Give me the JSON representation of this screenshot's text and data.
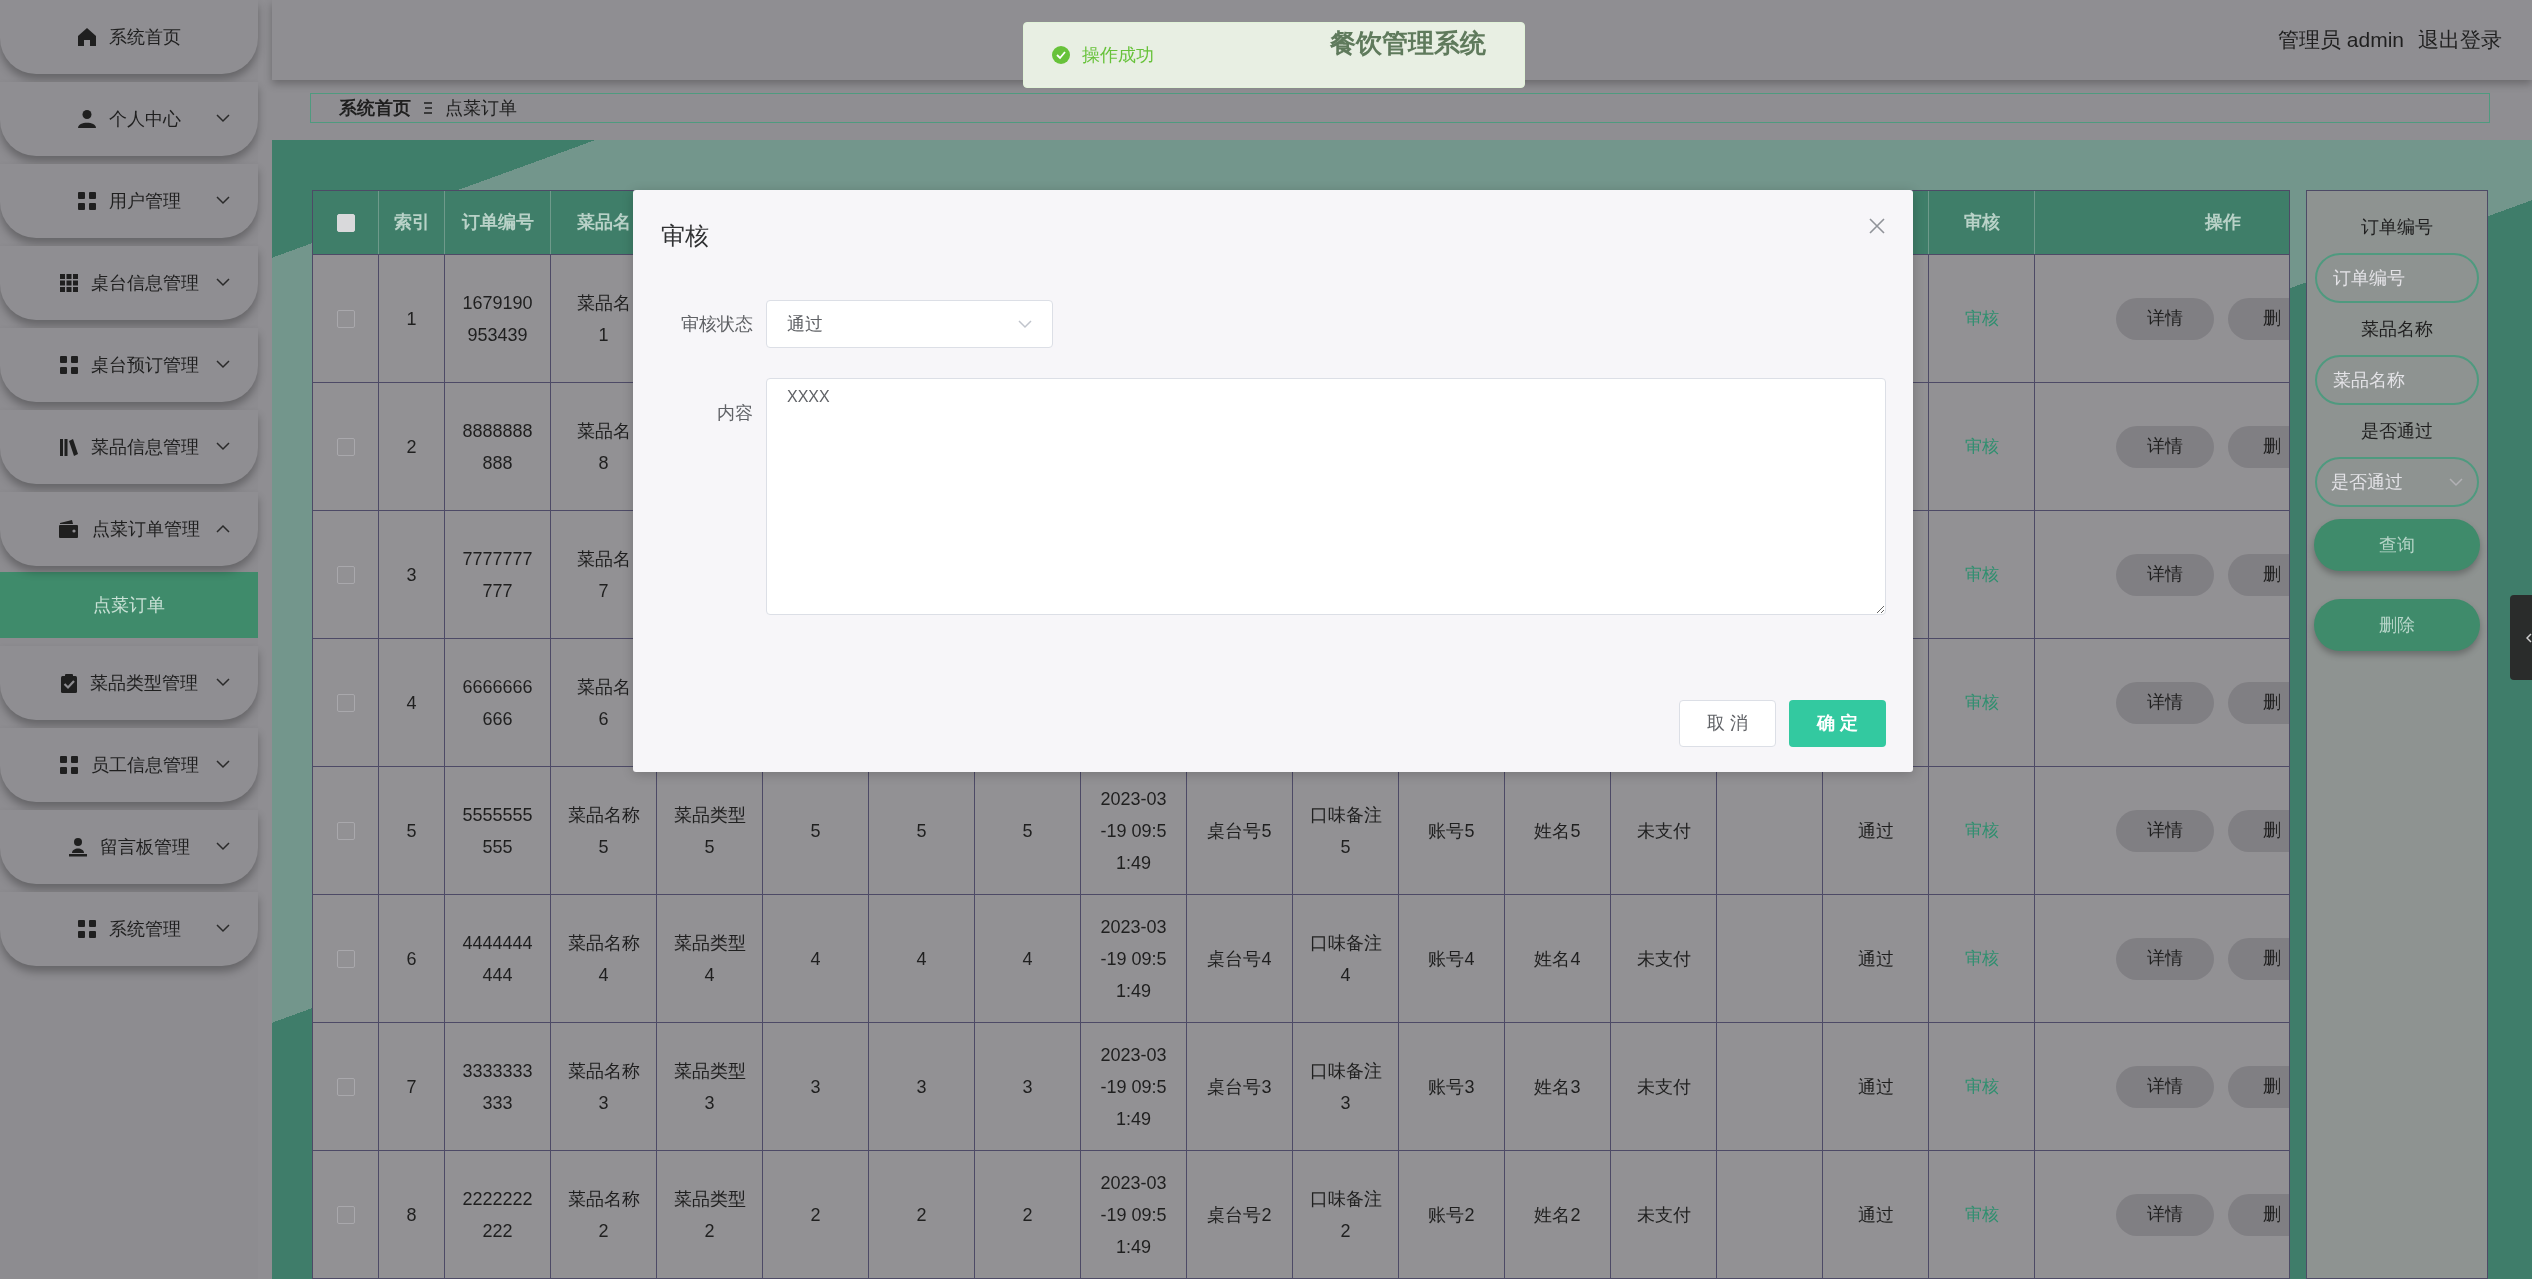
{
  "sidebar": {
    "items": [
      {
        "kind": "link",
        "label": "系统首页"
      },
      {
        "kind": "menu",
        "label": "个人中心",
        "expanded": false
      },
      {
        "kind": "menu",
        "label": "用户管理",
        "expanded": false
      },
      {
        "kind": "menu",
        "label": "桌台信息管理",
        "expanded": false
      },
      {
        "kind": "menu",
        "label": "桌台预订管理",
        "expanded": false
      },
      {
        "kind": "menu",
        "label": "菜品信息管理",
        "expanded": false
      },
      {
        "kind": "menu",
        "label": "点菜订单管理",
        "expanded": true,
        "children": [
          {
            "label": "点菜订单",
            "selected": true
          }
        ]
      },
      {
        "kind": "menu",
        "label": "菜品类型管理",
        "expanded": false
      },
      {
        "kind": "menu",
        "label": "员工信息管理",
        "expanded": false
      },
      {
        "kind": "menu",
        "label": "留言板管理",
        "expanded": false
      },
      {
        "kind": "menu",
        "label": "系统管理",
        "expanded": false
      }
    ]
  },
  "header": {
    "title": "餐饮管理系统",
    "user": "管理员 admin",
    "logout": "退出登录"
  },
  "toast": {
    "message": "操作成功"
  },
  "breadcrumb": [
    "系统首页",
    "点菜订单"
  ],
  "table": {
    "select_all": {
      "checked": false
    },
    "header": {
      "index": "索引",
      "order_no": "订单编号",
      "dish_name": "菜品名",
      "review": "审核",
      "actions": "操作"
    },
    "rows": [
      {
        "checked": false,
        "index": "1",
        "order_no": "1679190\n953439",
        "dish_name": "菜品名\n1",
        "review": "审核",
        "detail": "详情",
        "delete": "删"
      },
      {
        "checked": false,
        "index": "2",
        "order_no": "8888888\n888",
        "dish_name": "菜品名\n8",
        "review": "审核",
        "detail": "详情",
        "delete": "删"
      },
      {
        "checked": false,
        "index": "3",
        "order_no": "7777777\n777",
        "dish_name": "菜品名\n7",
        "review": "审核",
        "detail": "详情",
        "delete": "删"
      },
      {
        "checked": false,
        "index": "4",
        "order_no": "6666666\n666",
        "dish_name": "菜品名\n6",
        "review": "审核",
        "detail": "详情",
        "delete": "删"
      },
      {
        "checked": false,
        "index": "5",
        "order_no": "5555555\n555",
        "dish_name": "菜品名称\n5",
        "dish_type": "菜品类型\n5",
        "column_6": "5",
        "column_7": "5",
        "column_8": "5",
        "order_time": "2023-03\n-19 09:5\n1:49",
        "table_no": "桌台号5",
        "taste_note": "口味备注\n5",
        "account": "账号5",
        "name": "姓名5",
        "payment": "未支付",
        "review_status": "通过",
        "review": "审核",
        "detail": "详情",
        "delete": "删"
      },
      {
        "checked": false,
        "index": "6",
        "order_no": "4444444\n444",
        "dish_name": "菜品名称\n4",
        "dish_type": "菜品类型\n4",
        "column_6": "4",
        "column_7": "4",
        "column_8": "4",
        "order_time": "2023-03\n-19 09:5\n1:49",
        "table_no": "桌台号4",
        "taste_note": "口味备注\n4",
        "account": "账号4",
        "name": "姓名4",
        "payment": "未支付",
        "review_status": "通过",
        "review": "审核",
        "detail": "详情",
        "delete": "删"
      },
      {
        "checked": false,
        "index": "7",
        "order_no": "3333333\n333",
        "dish_name": "菜品名称\n3",
        "dish_type": "菜品类型\n3",
        "column_6": "3",
        "column_7": "3",
        "column_8": "3",
        "order_time": "2023-03\n-19 09:5\n1:49",
        "table_no": "桌台号3",
        "taste_note": "口味备注\n3",
        "account": "账号3",
        "name": "姓名3",
        "payment": "未支付",
        "review_status": "通过",
        "review": "审核",
        "detail": "详情",
        "delete": "删"
      },
      {
        "checked": false,
        "index": "8",
        "order_no": "2222222\n222",
        "dish_name": "菜品名称\n2",
        "dish_type": "菜品类型\n2",
        "column_6": "2",
        "column_7": "2",
        "column_8": "2",
        "order_time": "2023-03\n-19 09:5\n1:49",
        "table_no": "桌台号2",
        "taste_note": "口味备注\n2",
        "account": "账号2",
        "name": "姓名2",
        "payment": "未支付",
        "review_status": "通过",
        "review": "审核",
        "detail": "详情",
        "delete": "删"
      }
    ]
  },
  "search": {
    "fields": [
      {
        "kind": "input",
        "label": "订单编号",
        "placeholder": "订单编号"
      },
      {
        "kind": "input",
        "label": "菜品名称",
        "placeholder": "菜品名称"
      },
      {
        "kind": "select",
        "label": "是否通过",
        "placeholder": "是否通过"
      }
    ],
    "buttons": [
      "查询",
      "删除"
    ]
  },
  "dialog": {
    "title": "审核",
    "status_label": "审核状态",
    "status_value": "通过",
    "content_label": "内容",
    "content_value": "XXXX",
    "cancel": "取 消",
    "confirm": "确 定"
  }
}
